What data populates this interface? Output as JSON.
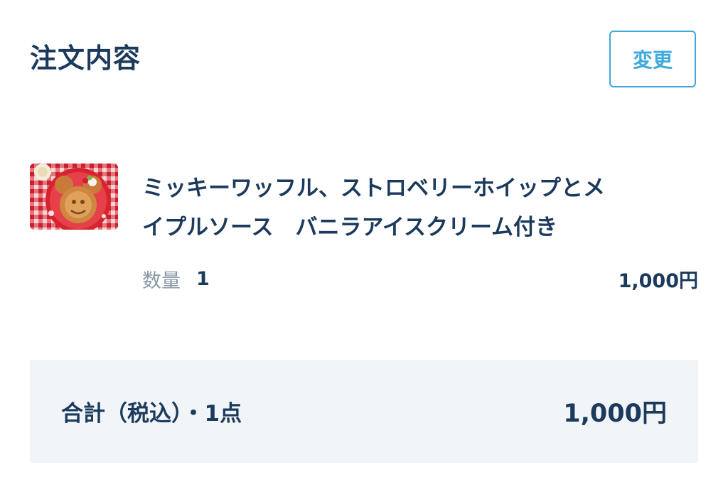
{
  "header": {
    "title": "注文内容",
    "change_label": "変更"
  },
  "item": {
    "image_alt": "waffle-photo",
    "name": "ミッキーワッフル、ストロベリーホイップとメ\nイプルソース　バニラアイスクリーム付き",
    "quantity_label": "数量",
    "quantity_value": "1",
    "price": "1,000円"
  },
  "summary": {
    "total_label": "合計（税込）・1点",
    "total_price": "1,000円"
  },
  "colors": {
    "text": "#1b3a5c",
    "accent": "#3fa9dd",
    "muted": "#8a97a6",
    "summary_bg": "#f1f5f8"
  }
}
